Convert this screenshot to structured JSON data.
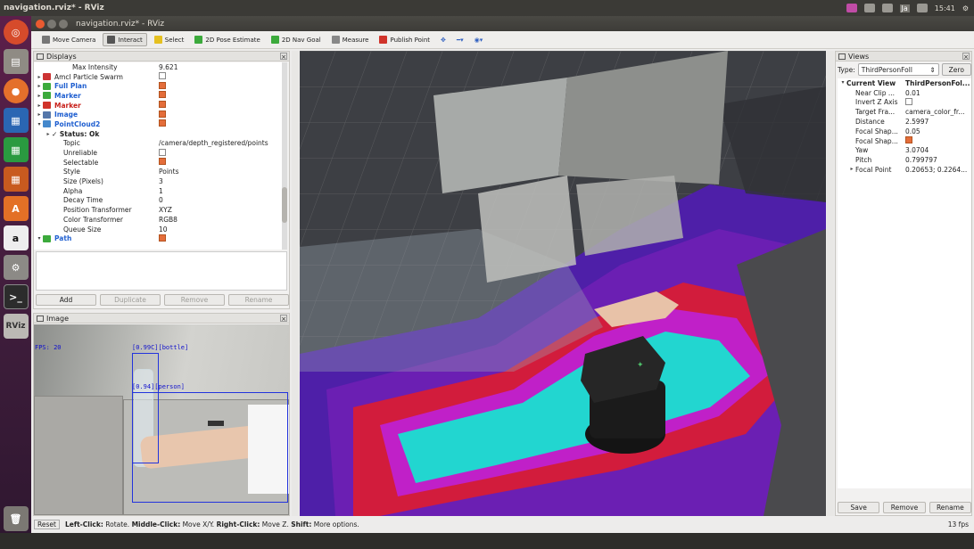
{
  "topbar": {
    "title": "navigation.rviz* - RViz",
    "keyboard": "Ja",
    "time": "15:41"
  },
  "launcher": {
    "items": [
      "ubuntu-home",
      "files",
      "firefox",
      "writer",
      "calc",
      "impress",
      "software-center",
      "amazon",
      "settings",
      "terminal",
      "rviz",
      "trash"
    ],
    "rviz_label": "RViz"
  },
  "window": {
    "title": "navigation.rviz* - RViz"
  },
  "toolbar": {
    "tools": [
      {
        "label": "Move Camera",
        "active": false,
        "color": "#777777"
      },
      {
        "label": "Interact",
        "active": true,
        "color": "#555555"
      },
      {
        "label": "Select",
        "active": false,
        "color": "#e5c020"
      },
      {
        "label": "2D Pose Estimate",
        "active": false,
        "color": "#3caa3c"
      },
      {
        "label": "2D Nav Goal",
        "active": false,
        "color": "#3caa3c"
      },
      {
        "label": "Measure",
        "active": false,
        "color": "#888888"
      },
      {
        "label": "Publish Point",
        "active": false,
        "color": "#d0332a"
      }
    ]
  },
  "displays": {
    "title": "Displays",
    "rows": [
      {
        "indent": 2,
        "arrow": "",
        "icon": "",
        "name": "Max Intensity",
        "value": "9.621",
        "style": "",
        "check": null
      },
      {
        "indent": 0,
        "arrow": "▸",
        "icon": "#cc3333",
        "name": "Amcl Particle Swarm",
        "value": "",
        "style": "",
        "check": false
      },
      {
        "indent": 0,
        "arrow": "▸",
        "icon": "#3caa3c",
        "name": "Full Plan",
        "value": "",
        "style": "blue",
        "check": true
      },
      {
        "indent": 0,
        "arrow": "▸",
        "icon": "#3caa3c",
        "name": "Marker",
        "value": "",
        "style": "blue",
        "check": true
      },
      {
        "indent": 0,
        "arrow": "▸",
        "icon": "#d0332a",
        "name": "Marker",
        "value": "",
        "style": "red",
        "check": true
      },
      {
        "indent": 0,
        "arrow": "▸",
        "icon": "#5577aa",
        "name": "Image",
        "value": "",
        "style": "blue",
        "check": true
      },
      {
        "indent": 0,
        "arrow": "▾",
        "icon": "#4488cc",
        "name": "PointCloud2",
        "value": "",
        "style": "blue",
        "check": true
      },
      {
        "indent": 1,
        "arrow": "▸",
        "icon": "",
        "name": "✓ Status: Ok",
        "value": "",
        "style": "bold",
        "check": null
      },
      {
        "indent": 1,
        "arrow": "",
        "icon": "",
        "name": "Topic",
        "value": "/camera/depth_registered/points",
        "style": "",
        "check": null
      },
      {
        "indent": 1,
        "arrow": "",
        "icon": "",
        "name": "Unreliable",
        "value": "",
        "style": "",
        "check": false
      },
      {
        "indent": 1,
        "arrow": "",
        "icon": "",
        "name": "Selectable",
        "value": "",
        "style": "",
        "check": true
      },
      {
        "indent": 1,
        "arrow": "",
        "icon": "",
        "name": "Style",
        "value": "Points",
        "style": "",
        "check": null
      },
      {
        "indent": 1,
        "arrow": "",
        "icon": "",
        "name": "Size (Pixels)",
        "value": "3",
        "style": "",
        "check": null
      },
      {
        "indent": 1,
        "arrow": "",
        "icon": "",
        "name": "Alpha",
        "value": "1",
        "style": "",
        "check": null
      },
      {
        "indent": 1,
        "arrow": "",
        "icon": "",
        "name": "Decay Time",
        "value": "0",
        "style": "",
        "check": null
      },
      {
        "indent": 1,
        "arrow": "",
        "icon": "",
        "name": "Position Transformer",
        "value": "XYZ",
        "style": "",
        "check": null
      },
      {
        "indent": 1,
        "arrow": "",
        "icon": "",
        "name": "Color Transformer",
        "value": "RGB8",
        "style": "",
        "check": null
      },
      {
        "indent": 1,
        "arrow": "",
        "icon": "",
        "name": "Queue Size",
        "value": "10",
        "style": "",
        "check": null
      },
      {
        "indent": 0,
        "arrow": "▾",
        "icon": "#3caa3c",
        "name": "Path",
        "value": "",
        "style": "blue",
        "check": true
      }
    ],
    "buttons": {
      "add": "Add",
      "duplicate": "Duplicate",
      "remove": "Remove",
      "rename": "Rename"
    }
  },
  "image_panel": {
    "title": "Image",
    "fps": "FPS: 20",
    "detections": [
      {
        "label": "[0.99C][bottle]"
      },
      {
        "label": "[0.94][person]"
      }
    ]
  },
  "views": {
    "title": "Views",
    "type_label": "Type:",
    "type_value": "ThirdPersonFoll",
    "zero": "Zero",
    "rows": [
      {
        "name": "Current View",
        "value": "ThirdPersonFol...",
        "header": true,
        "arrow": "▾",
        "check": null
      },
      {
        "name": "Near Clip ...",
        "value": "0.01",
        "header": false,
        "arrow": "",
        "check": null
      },
      {
        "name": "Invert Z Axis",
        "value": "",
        "header": false,
        "arrow": "",
        "check": false
      },
      {
        "name": "Target Fra...",
        "value": "camera_color_fr...",
        "header": false,
        "arrow": "",
        "check": null
      },
      {
        "name": "Distance",
        "value": "2.5997",
        "header": false,
        "arrow": "",
        "check": null
      },
      {
        "name": "Focal Shap...",
        "value": "0.05",
        "header": false,
        "arrow": "",
        "check": null
      },
      {
        "name": "Focal Shap...",
        "value": "",
        "header": false,
        "arrow": "",
        "check": true
      },
      {
        "name": "Yaw",
        "value": "3.0704",
        "header": false,
        "arrow": "",
        "check": null
      },
      {
        "name": "Pitch",
        "value": "0.799797",
        "header": false,
        "arrow": "",
        "check": null
      },
      {
        "name": "Focal Point",
        "value": "0.20653; 0.2264...",
        "header": false,
        "arrow": "▸",
        "check": null
      }
    ],
    "buttons": {
      "save": "Save",
      "remove": "Remove",
      "rename": "Rename"
    }
  },
  "status": {
    "reset": "Reset",
    "parts": [
      {
        "b": "Left-Click:",
        "t": " Rotate. "
      },
      {
        "b": "Middle-Click:",
        "t": " Move X/Y. "
      },
      {
        "b": "Right-Click:",
        "t": " Move Z. "
      },
      {
        "b": "Shift:",
        "t": " More options."
      }
    ],
    "fps": "13 fps"
  }
}
